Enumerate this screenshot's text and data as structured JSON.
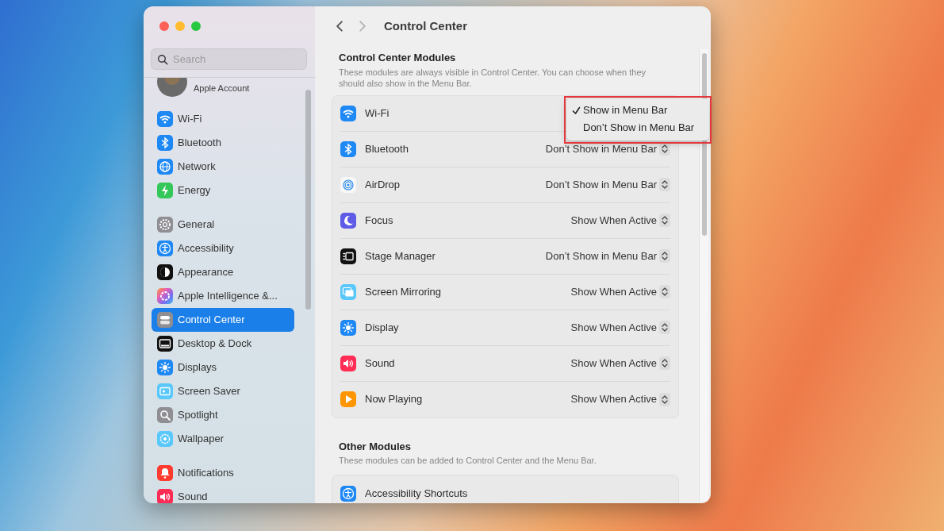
{
  "search": {
    "placeholder": "Search"
  },
  "account": {
    "label": "Apple Account"
  },
  "sidebar": {
    "groups": [
      {
        "items": [
          {
            "label": "Wi-Fi",
            "selected": false
          },
          {
            "label": "Bluetooth",
            "selected": false
          },
          {
            "label": "Network",
            "selected": false
          },
          {
            "label": "Energy",
            "selected": false
          }
        ]
      },
      {
        "items": [
          {
            "label": "General",
            "selected": false
          },
          {
            "label": "Accessibility",
            "selected": false
          },
          {
            "label": "Appearance",
            "selected": false
          },
          {
            "label": "Apple Intelligence &...",
            "selected": false
          },
          {
            "label": "Control Center",
            "selected": true
          },
          {
            "label": "Desktop & Dock",
            "selected": false
          },
          {
            "label": "Displays",
            "selected": false
          },
          {
            "label": "Screen Saver",
            "selected": false
          },
          {
            "label": "Spotlight",
            "selected": false
          },
          {
            "label": "Wallpaper",
            "selected": false
          }
        ]
      },
      {
        "items": [
          {
            "label": "Notifications",
            "selected": false
          },
          {
            "label": "Sound",
            "selected": false
          }
        ]
      }
    ]
  },
  "nav": {
    "back": {
      "disabled": false
    },
    "forward": {
      "disabled": true
    }
  },
  "page_title": "Control Center",
  "sections": [
    {
      "title": "Control Center Modules",
      "description": "These modules are always visible in Control Center. You can choose when they should also show in the Menu Bar.",
      "rows": [
        {
          "label": "Wi-Fi"
        },
        {
          "label": "Bluetooth",
          "value": "Don’t Show in Menu Bar"
        },
        {
          "label": "AirDrop",
          "value": "Don’t Show in Menu Bar"
        },
        {
          "label": "Focus",
          "value": "Show When Active"
        },
        {
          "label": "Stage Manager",
          "value": "Don’t Show in Menu Bar"
        },
        {
          "label": "Screen Mirroring",
          "value": "Show When Active"
        },
        {
          "label": "Display",
          "value": "Show When Active"
        },
        {
          "label": "Sound",
          "value": "Show When Active"
        },
        {
          "label": "Now Playing",
          "value": "Show When Active"
        }
      ]
    },
    {
      "title": "Other Modules",
      "description": "These modules can be added to Control Center and the Menu Bar.",
      "rows": [
        {
          "label": "Accessibility Shortcuts"
        }
      ]
    }
  ],
  "menu": {
    "items": [
      {
        "label": "Show in Menu Bar",
        "checked": true
      },
      {
        "label": "Don’t Show in Menu Bar",
        "checked": false
      }
    ]
  }
}
